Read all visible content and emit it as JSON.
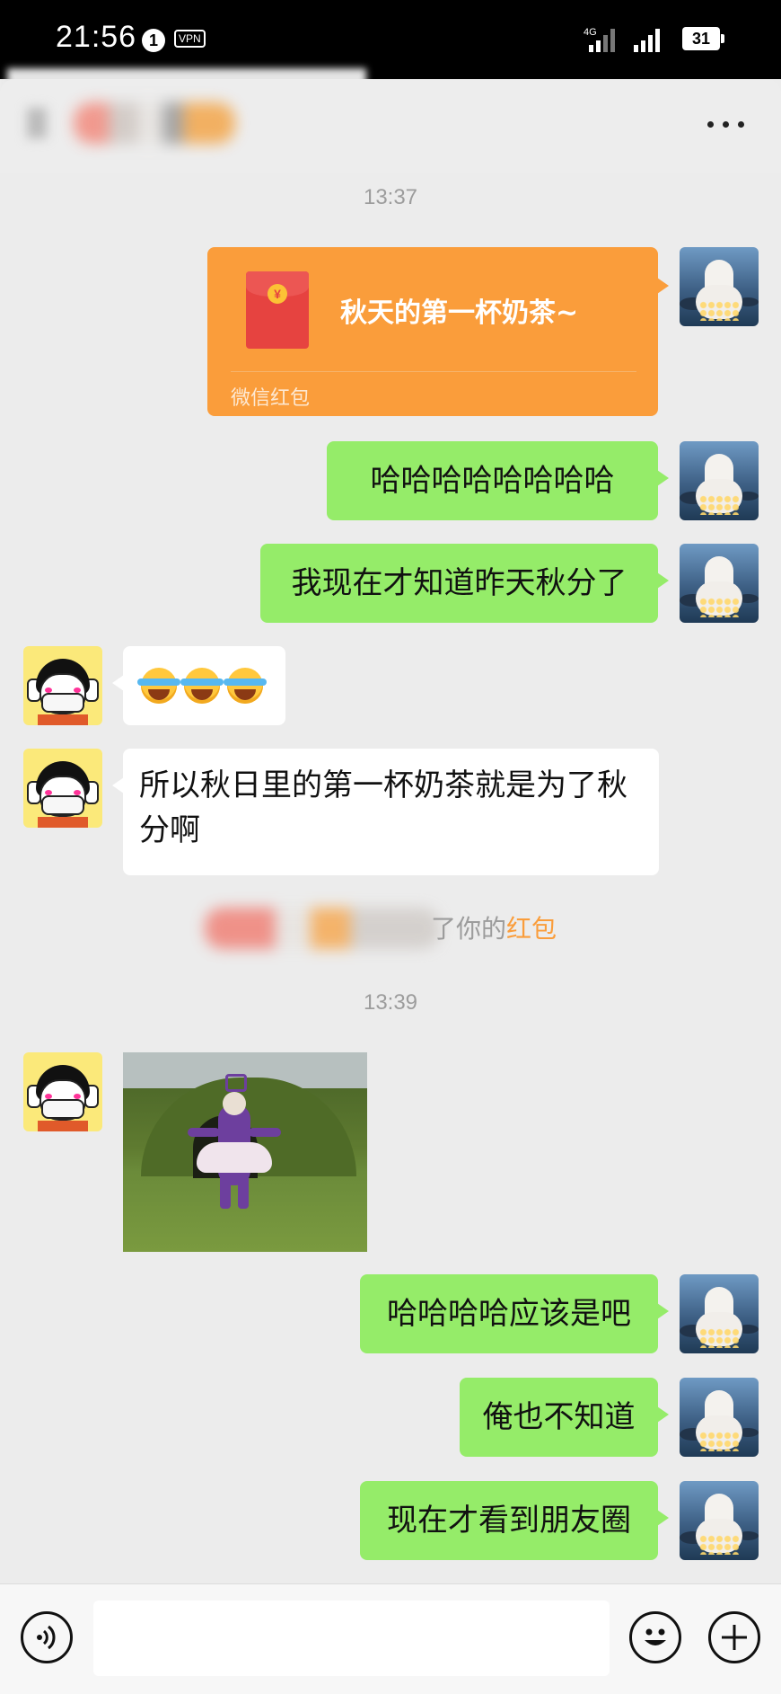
{
  "status_bar": {
    "time": "21:56",
    "notification_count": "1",
    "vpn": "VPN",
    "network": "4G",
    "battery": "31"
  },
  "header": {
    "more_icon": "more-dots-icon"
  },
  "timestamps": [
    "13:37",
    "13:39"
  ],
  "messages": {
    "red_packet": {
      "title": "秋天的第一杯奶茶~",
      "label": "微信红包",
      "coin": "¥"
    },
    "m1": "哈哈哈哈哈哈哈哈",
    "m2": "我现在才知道昨天秋分了",
    "m3_emoji": "facepalm-cry-emoji x3",
    "m4": "所以秋日里的第一杯奶茶就是为了秋分啊",
    "system_notice": {
      "text": "了你的",
      "link": "红包"
    },
    "m6": "哈哈哈哈应该是吧",
    "m7": "俺也不知道",
    "m8": "现在才看到朋友圈"
  },
  "colors": {
    "background": "#ececec",
    "bubble_sent": "#95ec69",
    "bubble_received": "#ffffff",
    "red_packet": "#fa9d3b",
    "timestamp": "#9c9c9c"
  }
}
